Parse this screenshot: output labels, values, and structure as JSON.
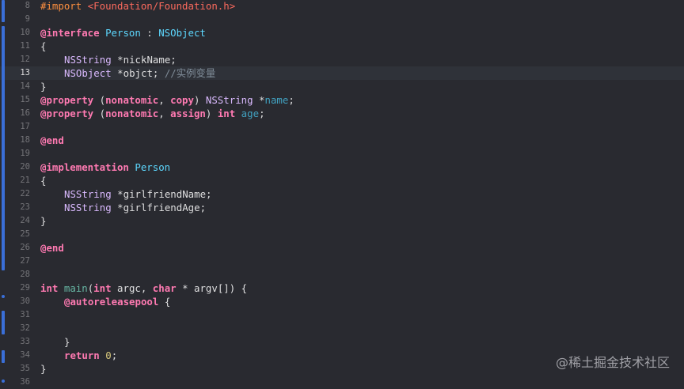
{
  "editor": {
    "current_line": 13,
    "lines": [
      {
        "num": "8",
        "indent": 0,
        "tokens": [
          {
            "t": "#import ",
            "c": "pp"
          },
          {
            "t": "<Foundation/Foundation.h>",
            "c": "str"
          }
        ]
      },
      {
        "num": "9",
        "indent": 0,
        "tokens": []
      },
      {
        "num": "10",
        "indent": 0,
        "tokens": [
          {
            "t": "@interface ",
            "c": "kw"
          },
          {
            "t": "Person",
            "c": "cls"
          },
          {
            "t": " : ",
            "c": "pl"
          },
          {
            "t": "NSObject",
            "c": "cls"
          }
        ]
      },
      {
        "num": "11",
        "indent": 0,
        "tokens": [
          {
            "t": "{",
            "c": "pl"
          }
        ]
      },
      {
        "num": "12",
        "indent": 1,
        "tokens": [
          {
            "t": "NSString",
            "c": "type"
          },
          {
            "t": " *nickName;",
            "c": "pl"
          }
        ]
      },
      {
        "num": "13",
        "indent": 1,
        "tokens": [
          {
            "t": "NSObject",
            "c": "type"
          },
          {
            "t": " *objct; ",
            "c": "pl"
          },
          {
            "t": "//实例变量",
            "c": "cmt"
          }
        ]
      },
      {
        "num": "14",
        "indent": 0,
        "tokens": [
          {
            "t": "}",
            "c": "pl"
          }
        ]
      },
      {
        "num": "15",
        "indent": 0,
        "tokens": [
          {
            "t": "@property",
            "c": "kw"
          },
          {
            "t": " (",
            "c": "pl"
          },
          {
            "t": "nonatomic",
            "c": "kw"
          },
          {
            "t": ", ",
            "c": "pl"
          },
          {
            "t": "copy",
            "c": "kw"
          },
          {
            "t": ") ",
            "c": "pl"
          },
          {
            "t": "NSString",
            "c": "type"
          },
          {
            "t": " *",
            "c": "pl"
          },
          {
            "t": "name",
            "c": "prop"
          },
          {
            "t": ";",
            "c": "pl"
          }
        ]
      },
      {
        "num": "16",
        "indent": 0,
        "tokens": [
          {
            "t": "@property",
            "c": "kw"
          },
          {
            "t": " (",
            "c": "pl"
          },
          {
            "t": "nonatomic",
            "c": "kw"
          },
          {
            "t": ", ",
            "c": "pl"
          },
          {
            "t": "assign",
            "c": "kw"
          },
          {
            "t": ") ",
            "c": "pl"
          },
          {
            "t": "int",
            "c": "kw"
          },
          {
            "t": " ",
            "c": "pl"
          },
          {
            "t": "age",
            "c": "prop"
          },
          {
            "t": ";",
            "c": "pl"
          }
        ]
      },
      {
        "num": "17",
        "indent": 0,
        "tokens": []
      },
      {
        "num": "18",
        "indent": 0,
        "tokens": [
          {
            "t": "@end",
            "c": "kw"
          }
        ]
      },
      {
        "num": "19",
        "indent": 0,
        "tokens": []
      },
      {
        "num": "20",
        "indent": 0,
        "tokens": [
          {
            "t": "@implementation ",
            "c": "kw"
          },
          {
            "t": "Person",
            "c": "cls"
          }
        ]
      },
      {
        "num": "21",
        "indent": 0,
        "tokens": [
          {
            "t": "{",
            "c": "pl"
          }
        ]
      },
      {
        "num": "22",
        "indent": 1,
        "tokens": [
          {
            "t": "NSString",
            "c": "type"
          },
          {
            "t": " *girlfriendName;",
            "c": "pl"
          }
        ]
      },
      {
        "num": "23",
        "indent": 1,
        "tokens": [
          {
            "t": "NSString",
            "c": "type"
          },
          {
            "t": " *girlfriendAge;",
            "c": "pl"
          }
        ]
      },
      {
        "num": "24",
        "indent": 0,
        "tokens": [
          {
            "t": "}",
            "c": "pl"
          }
        ]
      },
      {
        "num": "25",
        "indent": 0,
        "tokens": []
      },
      {
        "num": "26",
        "indent": 0,
        "tokens": [
          {
            "t": "@end",
            "c": "kw"
          }
        ]
      },
      {
        "num": "27",
        "indent": 0,
        "tokens": []
      },
      {
        "num": "28",
        "indent": 0,
        "tokens": []
      },
      {
        "num": "29",
        "indent": 0,
        "tokens": [
          {
            "t": "int",
            "c": "kw"
          },
          {
            "t": " ",
            "c": "pl"
          },
          {
            "t": "main",
            "c": "fn"
          },
          {
            "t": "(",
            "c": "pl"
          },
          {
            "t": "int",
            "c": "kw"
          },
          {
            "t": " argc, ",
            "c": "pl"
          },
          {
            "t": "char",
            "c": "kw"
          },
          {
            "t": " * argv[]) {",
            "c": "pl"
          }
        ]
      },
      {
        "num": "30",
        "indent": 1,
        "tokens": [
          {
            "t": "@autoreleasepool",
            "c": "kw"
          },
          {
            "t": " {",
            "c": "pl"
          }
        ]
      },
      {
        "num": "31",
        "indent": 0,
        "tokens": []
      },
      {
        "num": "32",
        "indent": 0,
        "tokens": []
      },
      {
        "num": "33",
        "indent": 1,
        "tokens": [
          {
            "t": "}",
            "c": "pl"
          }
        ]
      },
      {
        "num": "34",
        "indent": 1,
        "tokens": [
          {
            "t": "return",
            "c": "kw"
          },
          {
            "t": " ",
            "c": "pl"
          },
          {
            "t": "0",
            "c": "num"
          },
          {
            "t": ";",
            "c": "pl"
          }
        ]
      },
      {
        "num": "35",
        "indent": 0,
        "tokens": [
          {
            "t": "}",
            "c": "pl"
          }
        ]
      },
      {
        "num": "36",
        "indent": 0,
        "tokens": []
      }
    ]
  },
  "watermark": "@稀土掘金技术社区",
  "colors": {
    "background": "#292a30",
    "current_line_background": "#2f3239",
    "change_bar": "#3a6fd8",
    "keyword": "#ff7ab2",
    "preprocessor": "#fd8f3f",
    "string": "#fc6a5d",
    "type": "#dabaff",
    "class": "#5dd8ff",
    "property": "#41a1c0",
    "function": "#67b7a4",
    "number": "#d9c97c",
    "comment": "#7f8c98",
    "plain": "#dfdfe0"
  }
}
